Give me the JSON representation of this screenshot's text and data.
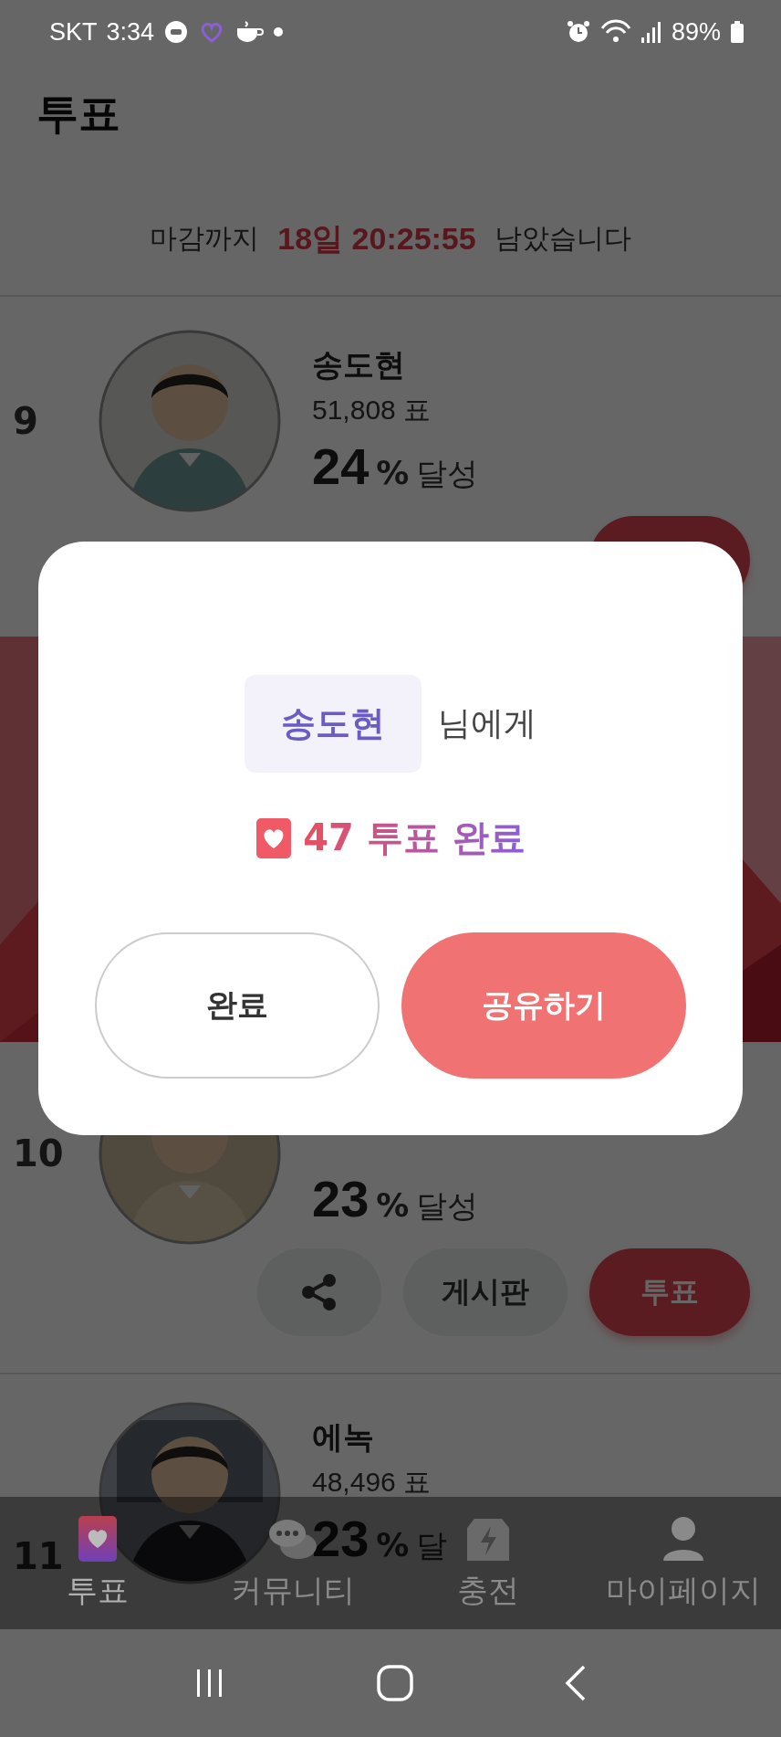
{
  "status_bar": {
    "carrier": "SKT",
    "time": "3:34",
    "battery": "89%"
  },
  "header": {
    "title": "투표"
  },
  "countdown": {
    "prefix": "마감까지",
    "time": "18일 20:25:55",
    "suffix": "남았습니다"
  },
  "rows": [
    {
      "rank": "9",
      "name": "송도현",
      "votes": "51,808 표",
      "percent": "24",
      "percent_unit": "%",
      "percent_label": "달성",
      "buttons": [
        {
          "kind": "vote"
        }
      ]
    },
    {
      "rank": "10",
      "percent": "23",
      "percent_unit": "%",
      "percent_label": "달성",
      "buttons": [
        {
          "kind": "share"
        },
        {
          "kind": "board",
          "label": "게시판"
        },
        {
          "kind": "vote",
          "label": "투표"
        }
      ]
    },
    {
      "rank": "11",
      "name": "에녹",
      "votes": "48,496 표",
      "percent": "23",
      "percent_unit": "%",
      "percent_label": "달",
      "buttons": []
    }
  ],
  "bottom_nav": [
    {
      "kind": "vote",
      "label": "투표",
      "selected": true
    },
    {
      "kind": "community",
      "label": "커뮤니티",
      "selected": false
    },
    {
      "kind": "charge",
      "label": "충전",
      "selected": false
    },
    {
      "kind": "mypage",
      "label": "마이페이지",
      "selected": false
    }
  ],
  "modal": {
    "recipient": "송도현",
    "recipient_suffix": "님에게",
    "result": "47 투표 완료",
    "buttons": [
      {
        "kind": "outline",
        "label": "완료"
      },
      {
        "kind": "primary",
        "label": "공유하기"
      }
    ]
  }
}
